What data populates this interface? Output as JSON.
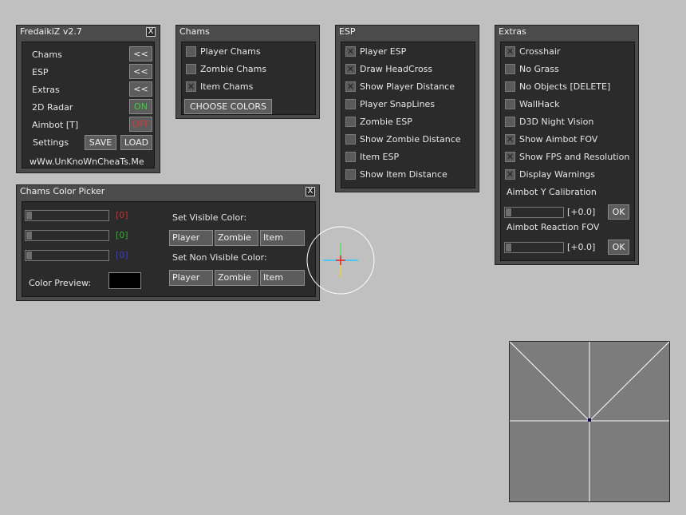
{
  "main_window": {
    "title": "FredaikiZ v2.7",
    "close": "X",
    "rows": [
      {
        "label": "Chams",
        "button": "<<"
      },
      {
        "label": "ESP",
        "button": "<<"
      },
      {
        "label": "Extras",
        "button": "<<"
      },
      {
        "label": "2D Radar",
        "button": "ON"
      },
      {
        "label": "Aimbot [T]",
        "button": "OFF"
      }
    ],
    "settings_label": "Settings",
    "save_label": "SAVE",
    "load_label": "LOAD",
    "footer": "wWw.UnKnoWnCheaTs.Me",
    "on_color": "#3ecf3e",
    "off_color": "#d23a3a"
  },
  "chams_window": {
    "title": "Chams",
    "items": [
      {
        "label": "Player Chams",
        "checked": false
      },
      {
        "label": "Zombie Chams",
        "checked": false
      },
      {
        "label": "Item Chams",
        "checked": true
      }
    ],
    "choose_colors": "CHOOSE COLORS"
  },
  "esp_window": {
    "title": "ESP",
    "items": [
      {
        "label": "Player ESP",
        "checked": true
      },
      {
        "label": "Draw HeadCross",
        "checked": true
      },
      {
        "label": "Show Player Distance",
        "checked": true
      },
      {
        "label": "Player SnapLines",
        "checked": false
      },
      {
        "label": "Zombie ESP",
        "checked": false
      },
      {
        "label": "Show Zombie Distance",
        "checked": false
      },
      {
        "label": "Item ESP",
        "checked": false
      },
      {
        "label": "Show Item Distance",
        "checked": false
      }
    ]
  },
  "extras_window": {
    "title": "Extras",
    "items": [
      {
        "label": "Crosshair",
        "checked": true
      },
      {
        "label": "No Grass",
        "checked": false
      },
      {
        "label": "No Objects [DELETE]",
        "checked": false
      },
      {
        "label": "WallHack",
        "checked": false
      },
      {
        "label": "D3D Night Vision",
        "checked": false
      },
      {
        "label": "Show Aimbot FOV",
        "checked": true
      },
      {
        "label": "Show FPS and Resolution",
        "checked": true
      },
      {
        "label": "Display Warnings",
        "checked": true
      }
    ],
    "aimbot_y_label": "Aimbot Y Calibration",
    "aimbot_y_value": "[+0.0]",
    "aimbot_y_ok": "OK",
    "aimbot_fov_label": "Aimbot Reaction FOV",
    "aimbot_fov_value": "[+0.0]",
    "aimbot_fov_ok": "OK"
  },
  "color_picker": {
    "title": "Chams Color Picker",
    "close": "X",
    "sliders": [
      {
        "value": "[0]",
        "color": "#c83232"
      },
      {
        "value": "[0]",
        "color": "#32b432"
      },
      {
        "value": "[0]",
        "color": "#3c3cd2"
      }
    ],
    "visible_label": "Set Visible Color:",
    "non_visible_label": "Set Non Visible Color:",
    "targets": [
      "Player",
      "Zombie",
      "Item"
    ],
    "preview_label": "Color Preview:",
    "preview_color": "#000000"
  },
  "radar": {
    "background": "#7c7c7c"
  }
}
